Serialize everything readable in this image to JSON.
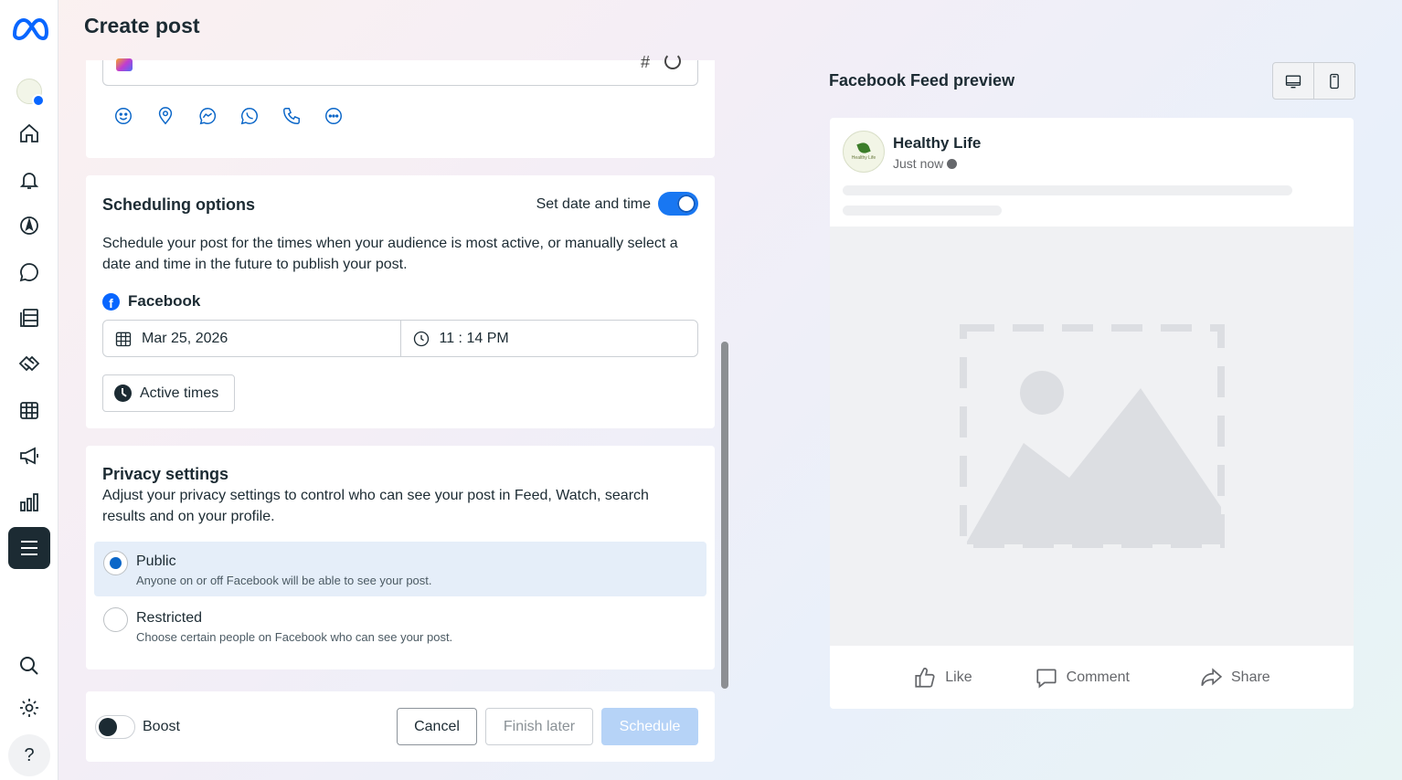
{
  "page": {
    "title": "Create post"
  },
  "colors": {
    "accent": "#1877f2",
    "primary_dark": "#1c2b33",
    "schedule_disabled": "#b6d3f7"
  },
  "sidebar": {
    "items": [
      {
        "name": "home",
        "icon": "home-icon"
      },
      {
        "name": "notifications",
        "icon": "bell-icon"
      },
      {
        "name": "navigate",
        "icon": "compass-icon"
      },
      {
        "name": "messages",
        "icon": "chat-bubble-icon"
      },
      {
        "name": "content",
        "icon": "pages-icon"
      },
      {
        "name": "engagement",
        "icon": "handshake-icon"
      },
      {
        "name": "planner",
        "icon": "calendar-grid-icon"
      },
      {
        "name": "ads",
        "icon": "megaphone-icon"
      },
      {
        "name": "insights",
        "icon": "bar-chart-icon"
      },
      {
        "name": "all-tools",
        "icon": "menu-icon",
        "active": true
      }
    ],
    "bottom": [
      {
        "name": "search",
        "icon": "search-icon"
      },
      {
        "name": "settings",
        "icon": "gear-icon"
      },
      {
        "name": "help",
        "icon": "help-icon",
        "label": "?"
      }
    ]
  },
  "composer": {
    "hashtag_symbol": "#",
    "tools": [
      "emoji-icon",
      "location-icon",
      "messenger-icon",
      "whatsapp-icon",
      "phone-icon",
      "more-icon"
    ]
  },
  "scheduling": {
    "title": "Scheduling options",
    "toggle_label": "Set date and time",
    "toggle_on": true,
    "description": "Schedule your post for the times when your audience is most active, or manually select a date and time in the future to publish your post.",
    "platform_glyph": "f",
    "platform": "Facebook",
    "date": "Mar 25, 2026",
    "time": "11 : 14 PM",
    "active_times_label": "Active times"
  },
  "privacy": {
    "title": "Privacy settings",
    "description": "Adjust your privacy settings to control who can see your post in Feed, Watch, search results and on your profile.",
    "options": [
      {
        "label": "Public",
        "sub": "Anyone on or off Facebook will be able to see your post.",
        "selected": true
      },
      {
        "label": "Restricted",
        "sub": "Choose certain people on Facebook who can see your post.",
        "selected": false
      }
    ]
  },
  "footer": {
    "boost_label": "Boost",
    "boost_on": false,
    "cancel_label": "Cancel",
    "finish_later_label": "Finish later",
    "schedule_label": "Schedule"
  },
  "preview": {
    "title": "Facebook Feed preview",
    "page_name": "Healthy Life",
    "avatar_text": "Healthy Life",
    "time": "Just now",
    "actions": [
      "Like",
      "Comment",
      "Share"
    ]
  }
}
